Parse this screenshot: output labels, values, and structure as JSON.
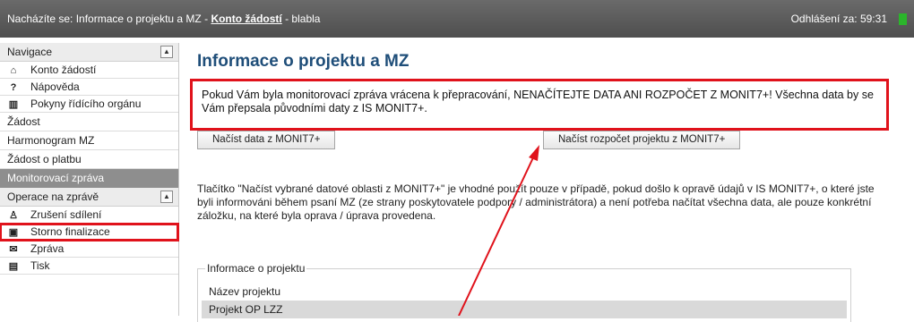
{
  "topbar": {
    "prefix": "Nacházíte se: Informace o projektu a MZ - ",
    "link": "Konto žádostí",
    "suffix": " - blabla",
    "logout": "Odhlášení za: 59:31"
  },
  "sidebar": {
    "nav_header": "Navigace",
    "nav_items": [
      {
        "icon": "home-icon",
        "glyph": "⌂",
        "label": "Konto žádostí"
      },
      {
        "icon": "help-icon",
        "glyph": "?",
        "label": "Nápověda"
      },
      {
        "icon": "book-icon",
        "glyph": "▥",
        "label": "Pokyny řídícího orgánu"
      }
    ],
    "sections": [
      "Žádost",
      "Harmonogram MZ",
      "Žádost o platbu"
    ],
    "active": "Monitorovací zpráva",
    "ops_header": "Operace na zprávě",
    "ops_items": [
      {
        "icon": "user-icon",
        "glyph": "♙",
        "label": "Zrušení sdílení"
      },
      {
        "icon": "lock-icon",
        "glyph": "🔒",
        "label": "Storno finalizace"
      },
      {
        "icon": "mail-icon",
        "glyph": "✉",
        "label": "Zpráva"
      },
      {
        "icon": "print-icon",
        "glyph": "▤",
        "label": "Tisk"
      }
    ]
  },
  "main": {
    "title": "Informace o projektu a MZ",
    "warning": "Pokud Vám byla monitorovací zpráva vrácena k přepracování, NENAČÍTEJTE DATA ANI ROZPOČET Z MONIT7+! Všechna data by se Vám přepsala původními daty z IS MONIT7+.",
    "btn_load_data": "Načíst data z MONIT7+",
    "btn_load_budget": "Načíst rozpočet projektu z MONIT7+",
    "info": "Tlačítko \"Načíst vybrané datové oblasti z MONIT7+\" je vhodné použít pouze v případě, pokud došlo k opravě údajů v IS MONIT7+, o které jste byli informováni během psaní MZ (ze strany poskytovatele podpory / administrátora) a není potřeba načítat všechna data, ale pouze konkrétní záložku, na které byla oprava / úprava provedena.",
    "fieldset_legend": "Informace o projektu",
    "field_name_label": "Název projektu",
    "field_name_value": "Projekt OP LZZ"
  },
  "colors": {
    "highlight": "#e0121b",
    "title": "#1f4e79",
    "topbar": "#5a5a5a",
    "active_item": "#8e8e8e"
  }
}
